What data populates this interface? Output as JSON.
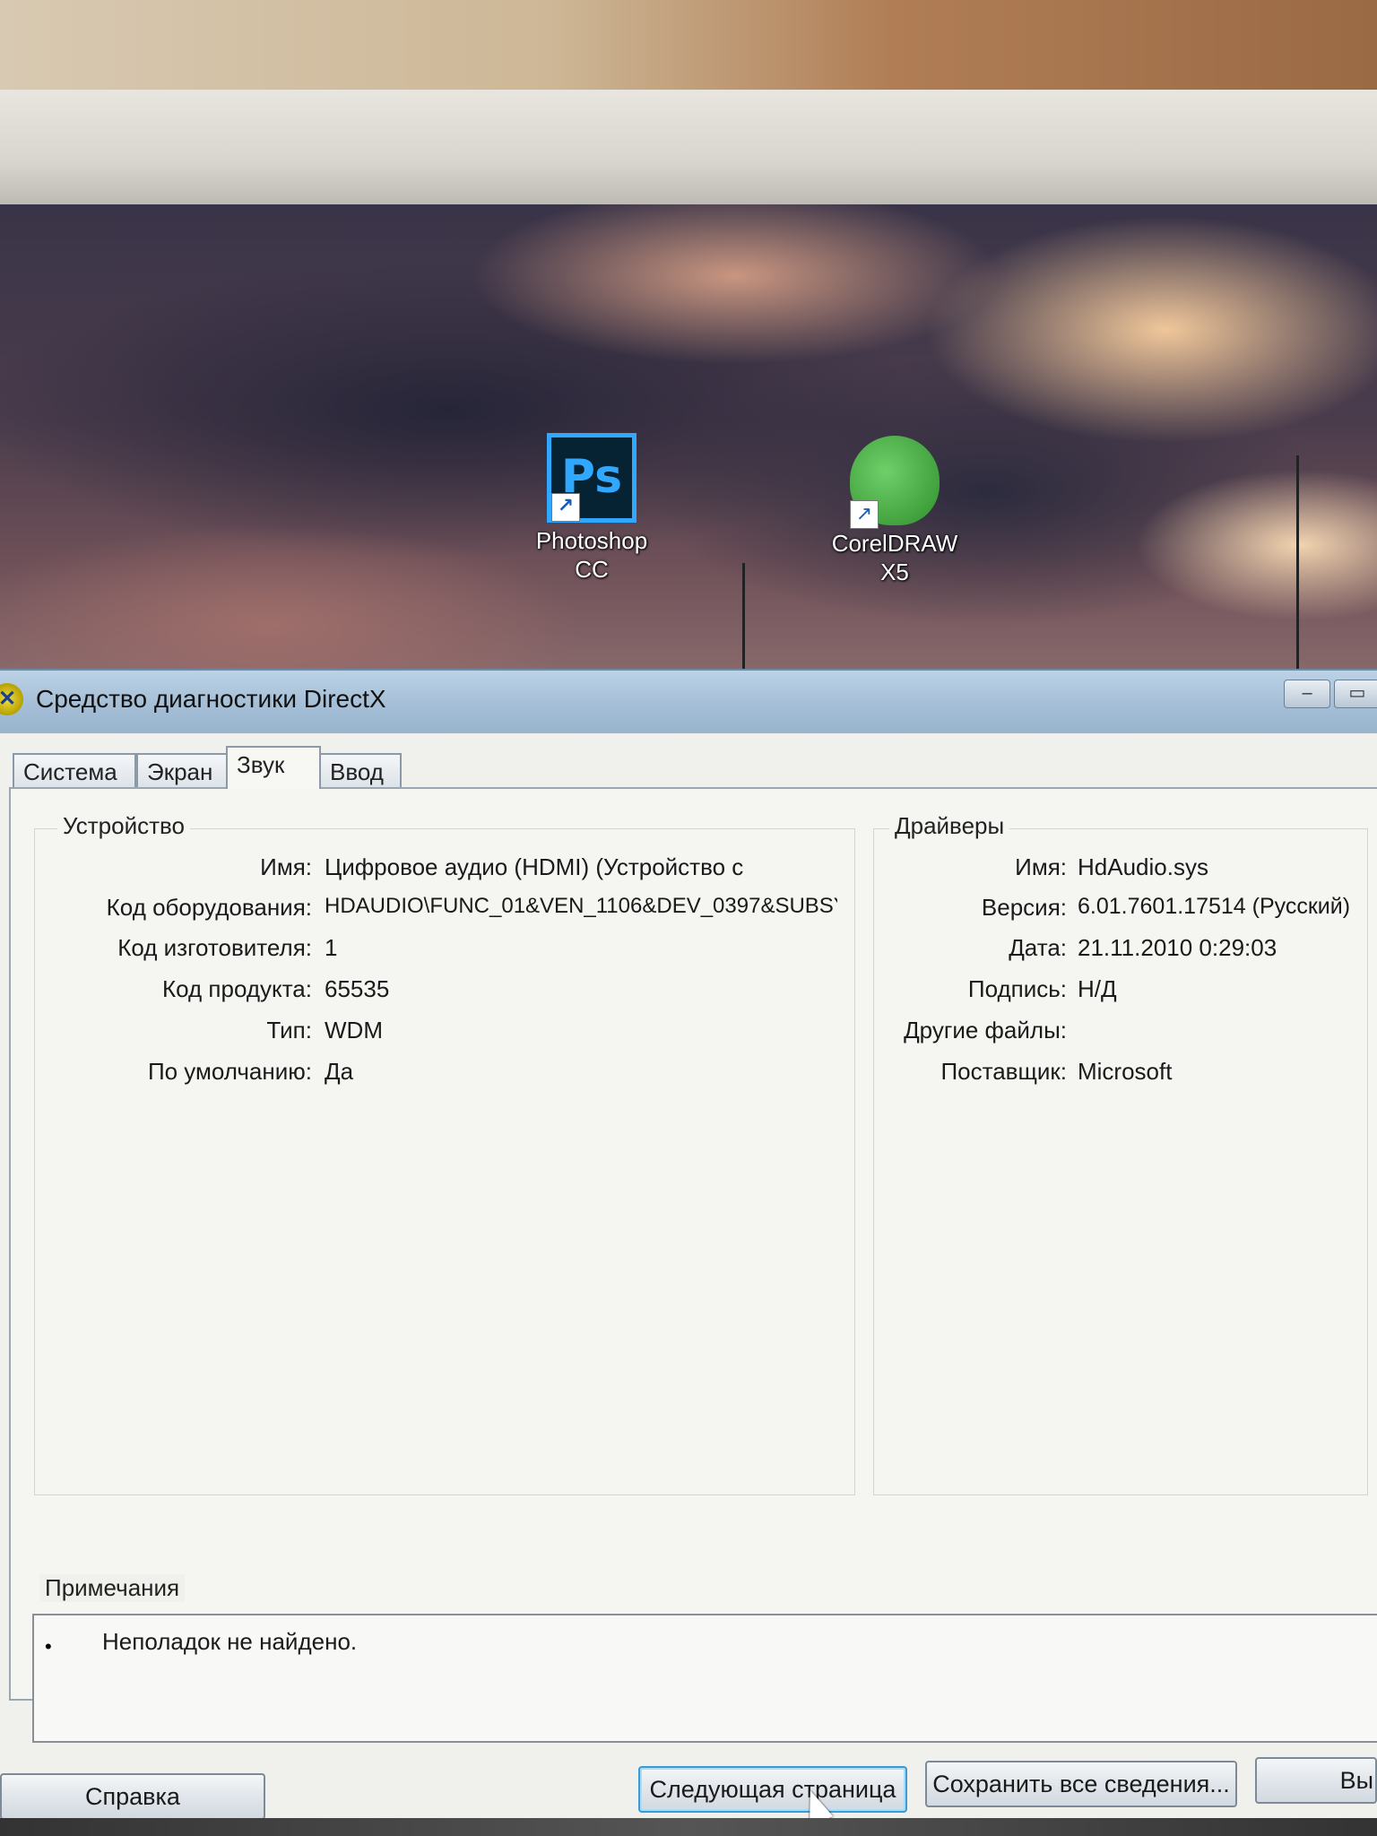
{
  "desktop": {
    "icons": [
      {
        "label_line1": "Photoshop",
        "label_line2": "CC",
        "glyph": "Ps"
      },
      {
        "label_line1": "CorelDRAW",
        "label_line2": "X5",
        "glyph": "corel-balloon-icon"
      }
    ]
  },
  "window": {
    "title": "Средство диагностики DirectX",
    "icon": "directx-icon",
    "controls": {
      "minimize": "–",
      "maximize": "▭"
    }
  },
  "tabs": [
    {
      "label": "Система",
      "active": false
    },
    {
      "label": "Экран",
      "active": false
    },
    {
      "label": "Звук",
      "active": true
    },
    {
      "label": "Ввод",
      "active": false
    }
  ],
  "device": {
    "group_label": "Устройство",
    "rows": [
      {
        "label": "Имя:",
        "value": "Цифровое аудио (HDMI) (Устройство с"
      },
      {
        "label": "Код оборудования:",
        "value": "HDAUDIO\\FUNC_01&VEN_1106&DEV_0397&SUBSY"
      },
      {
        "label": "Код изготовителя:",
        "value": "1"
      },
      {
        "label": "Код продукта:",
        "value": "65535"
      },
      {
        "label": "Тип:",
        "value": "WDM"
      },
      {
        "label": "По умолчанию:",
        "value": "Да"
      }
    ]
  },
  "drivers": {
    "group_label": "Драйверы",
    "rows": [
      {
        "label": "Имя:",
        "value": "HdAudio.sys"
      },
      {
        "label": "Версия:",
        "value": "6.01.7601.17514 (Русский)"
      },
      {
        "label": "Дата:",
        "value": "21.11.2010 0:29:03"
      },
      {
        "label": "Подпись:",
        "value": "Н/Д"
      },
      {
        "label": "Другие файлы:",
        "value": ""
      },
      {
        "label": "Поставщик:",
        "value": "Microsoft"
      }
    ]
  },
  "notes": {
    "label": "Примечания",
    "bullet": "•",
    "items": [
      "Неполадок не найдено."
    ]
  },
  "buttons": {
    "help": "Справка",
    "next_page": "Следующая страница",
    "save_all": "Сохранить все сведения...",
    "exit_partial": "Вы"
  }
}
